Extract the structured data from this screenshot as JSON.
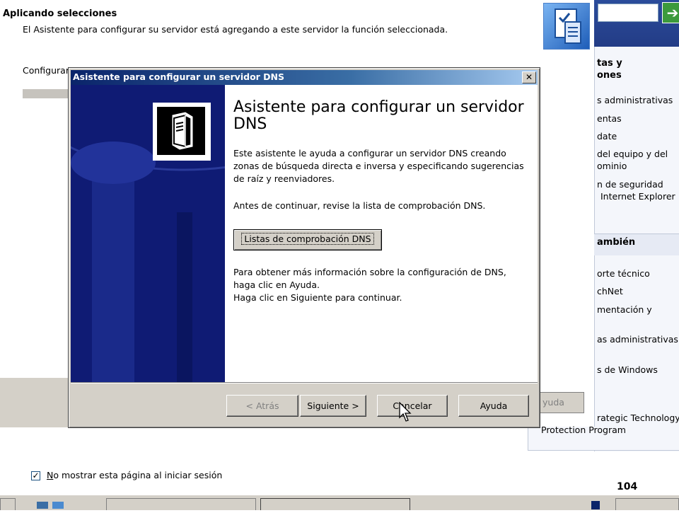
{
  "background_wizard": {
    "title": "Aplicando selecciones",
    "subtitle": "El Asistente para configurar su servidor está agregando a este servidor la función seleccionada.",
    "configuring_label": "Configurar",
    "help_button": "yuda"
  },
  "right_pane": {
    "section1_title_line1": "tas y",
    "section1_title_line2": "ones",
    "links1": [
      "s administrativas",
      "entas",
      "date",
      "del equipo y del",
      "ominio",
      "n de seguridad",
      "Internet Explorer"
    ],
    "section2_title": "ambién",
    "links2": [
      "orte técnico",
      "chNet",
      "mentación y",
      "as administrativas",
      "s de Windows",
      "rategic Technology",
      "Protection Program"
    ]
  },
  "footer": {
    "checkbox_mark": "✓",
    "checkbox_label_u": "N",
    "checkbox_label_rest": "o mostrar esta página al iniciar sesión",
    "page_number": "104"
  },
  "dialog": {
    "title": "Asistente para configurar un servidor DNS",
    "close_glyph": "✕",
    "heading": "Asistente para configurar un servidor DNS",
    "intro": "Este asistente le ayuda a configurar un servidor DNS creando zonas de búsqueda directa e inversa y especificando sugerencias de raíz y reenviadores.",
    "before": "Antes de continuar, revise la lista de comprobación DNS.",
    "checklist_button": "Listas de comprobación DNS",
    "more_info_1": "Para obtener más información sobre la configuración de DNS, haga clic en Ayuda.",
    "more_info_2": "Haga clic en Siguiente para continuar.",
    "buttons": {
      "back": "< Atrás",
      "next": "Siguiente >",
      "cancel": "Cancelar",
      "help": "Ayuda"
    }
  },
  "colors": {
    "sidebar": "#0f1b74",
    "titlebar": "#0a246a",
    "dialog_face": "#d4d0c8"
  }
}
